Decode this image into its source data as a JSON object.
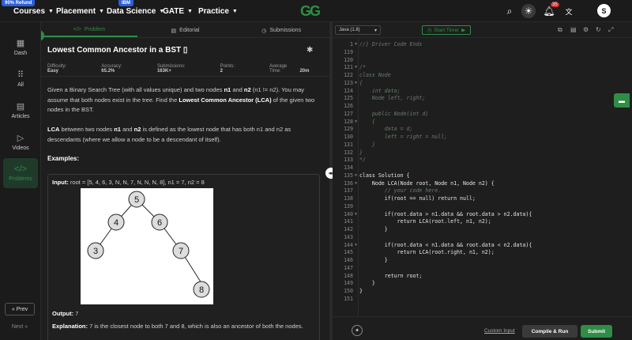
{
  "topbar": {
    "courses_badge": "90% Refund",
    "courses": "Courses",
    "placement": "Placement",
    "datascience_badge": "IBM",
    "datascience": "Data Science",
    "gate": "GATE",
    "practice": "Practice",
    "logo_text": "GG",
    "notification_count": "35",
    "avatar_letter": "S"
  },
  "sidebar": {
    "items": [
      {
        "label": "Dash",
        "icon": "dashboard-icon"
      },
      {
        "label": "All",
        "icon": "grid-icon"
      },
      {
        "label": "Articles",
        "icon": "article-icon"
      },
      {
        "label": "Videos",
        "icon": "video-icon"
      },
      {
        "label": "Problems",
        "icon": "code-icon"
      }
    ],
    "prev": "« Prev",
    "next": "Next »"
  },
  "tabs": {
    "problem": "Problem",
    "editorial": "Editorial",
    "submissions": "Submissions"
  },
  "problem": {
    "title": "Lowest Common Ancestor in a BST",
    "difficulty_label": "Difficulty:",
    "difficulty": "Easy",
    "accuracy_label": "Accuracy:",
    "accuracy": "65.2%",
    "submissions_label": "Submissions:",
    "submissions": "163K+",
    "points_label": "Points:",
    "points": "2",
    "time_label": "Average Time:",
    "time": "20m",
    "p1_a": "Given a Binary Search Tree (with all values unique) and two nodes ",
    "p1_n1": "n1",
    "p1_and": " and ",
    "p1_n2": "n2",
    "p1_b": " (n1 != n2). You may assume that both nodes exist in the tree. Find the ",
    "p1_lca": "Lowest Common Ancestor (LCA)",
    "p1_c": " of the given two nodes in the BST.",
    "p2_lca": "LCA",
    "p2_a": " between two nodes ",
    "p2_n1": "n1",
    "p2_and": " and ",
    "p2_n2": "n2",
    "p2_b": " is defined as the lowest node that has both n1 and n2 as descendants (where we allow a node to be a descendant of itself).",
    "examples": "Examples:",
    "input_label": "Input:",
    "input_value": " root = [5, 4, 6, 3, N, N, 7, N, N, N, 8], n1 = 7, n2 = 8",
    "output_label": "Output:",
    "output_value": " 7",
    "expl_label": "Explanation:",
    "expl_value": " 7 is the closest node to both 7 and 8, which is also an ancestor of both the nodes."
  },
  "tree_nodes": [
    "5",
    "4",
    "6",
    "3",
    "7",
    "8"
  ],
  "editor": {
    "language": "Java (1.8)",
    "timer": "Start Timer",
    "custom_input": "Custom Input",
    "compile": "Compile & Run",
    "submit": "Submit",
    "lines": [
      {
        "n": "1",
        "t": "//} Driver Code Ends",
        "c": true,
        "f": true
      },
      {
        "n": "119",
        "t": ""
      },
      {
        "n": "120",
        "t": ""
      },
      {
        "n": "121",
        "t": "/*",
        "c": true,
        "f": true
      },
      {
        "n": "122",
        "t": "class Node",
        "c": true
      },
      {
        "n": "123",
        "t": "{",
        "c": true,
        "f": true
      },
      {
        "n": "124",
        "t": "    int data;",
        "c": true
      },
      {
        "n": "125",
        "t": "    Node left, right;",
        "c": true
      },
      {
        "n": "126",
        "t": "",
        "c": true
      },
      {
        "n": "127",
        "t": "    public Node(int d)",
        "c": true
      },
      {
        "n": "128",
        "t": "    {",
        "c": true,
        "f": true
      },
      {
        "n": "129",
        "t": "        data = d;",
        "c": true
      },
      {
        "n": "130",
        "t": "        left = right = null;",
        "c": true
      },
      {
        "n": "131",
        "t": "    }",
        "c": true
      },
      {
        "n": "132",
        "t": "}",
        "c": true
      },
      {
        "n": "133",
        "t": "*/",
        "c": true
      },
      {
        "n": "134",
        "t": ""
      },
      {
        "n": "135",
        "t": "class Solution {",
        "f": true
      },
      {
        "n": "136",
        "t": "    Node LCA(Node root, Node n1, Node n2) {",
        "f": true
      },
      {
        "n": "137",
        "t": "        // your code here.",
        "c": true
      },
      {
        "n": "138",
        "t": "        if(root == null) return null;"
      },
      {
        "n": "139",
        "t": ""
      },
      {
        "n": "140",
        "t": "        if(root.data > n1.data && root.data > n2.data){",
        "f": true
      },
      {
        "n": "141",
        "t": "            return LCA(root.left, n1, n2);"
      },
      {
        "n": "142",
        "t": "        }"
      },
      {
        "n": "143",
        "t": ""
      },
      {
        "n": "144",
        "t": "        if(root.data < n1.data && root.data < n2.data){",
        "f": true
      },
      {
        "n": "145",
        "t": "            return LCA(root.right, n1, n2);"
      },
      {
        "n": "146",
        "t": "        }"
      },
      {
        "n": "147",
        "t": ""
      },
      {
        "n": "148",
        "t": "        return root;"
      },
      {
        "n": "149",
        "t": "    }"
      },
      {
        "n": "150",
        "t": "}"
      },
      {
        "n": "151",
        "t": ""
      }
    ]
  },
  "colors": {
    "accent": "#2f8d46",
    "background": "#1e1e1e"
  }
}
